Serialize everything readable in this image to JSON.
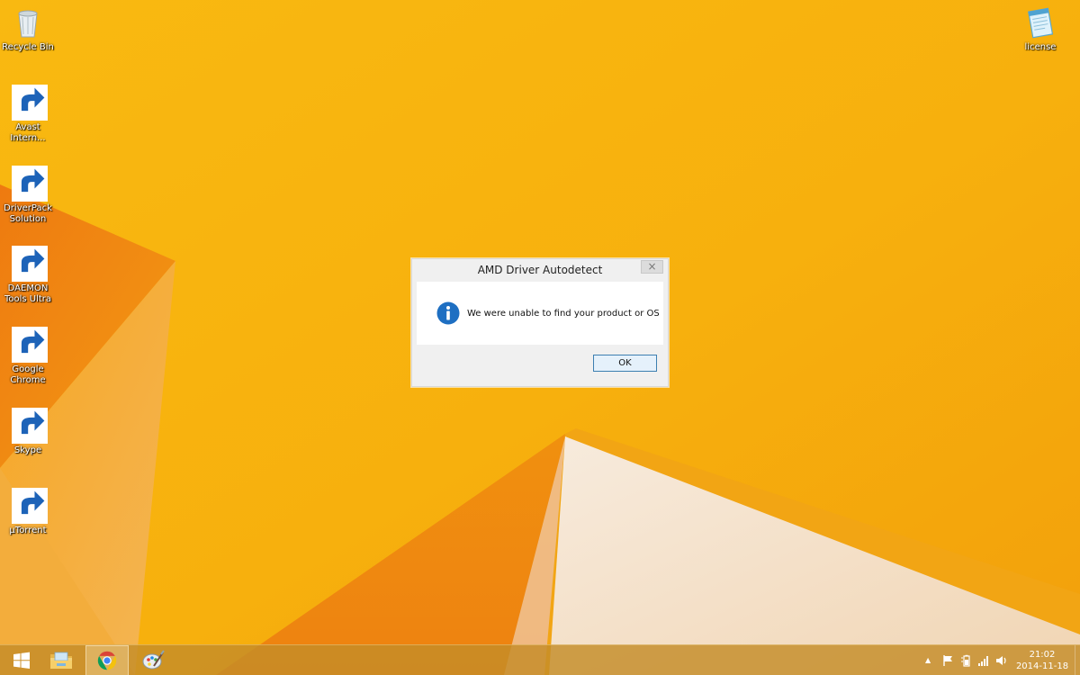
{
  "desktop_icons": [
    {
      "label": "Recycle Bin",
      "icon": "recycle-bin-icon"
    },
    {
      "label": "Avast Intern...",
      "icon": "avast-icon"
    },
    {
      "label": "DriverPack Solution",
      "icon": "driverpack-icon"
    },
    {
      "label": "DAEMON Tools Ultra",
      "icon": "daemon-tools-icon"
    },
    {
      "label": "Google Chrome",
      "icon": "chrome-icon"
    },
    {
      "label": "Skype",
      "icon": "skype-icon"
    },
    {
      "label": "µTorrent",
      "icon": "utorrent-icon"
    },
    {
      "label": "license",
      "icon": "notepad-icon"
    }
  ],
  "dialog": {
    "title": "AMD Driver Autodetect",
    "close_label": "×",
    "message": "We were unable to find your product or OS",
    "ok_label": "OK",
    "icon": "info-icon"
  },
  "taskbar": {
    "items": [
      {
        "name": "start",
        "icon": "windows-logo-icon"
      },
      {
        "name": "file-explorer",
        "icon": "folder-icon"
      },
      {
        "name": "google-chrome",
        "icon": "chrome-icon",
        "active": true
      },
      {
        "name": "paint-app",
        "icon": "paint-palette-icon"
      }
    ]
  },
  "tray": {
    "icons": [
      "show-hidden-icons-icon",
      "action-center-flag-icon",
      "battery-power-icon",
      "network-signal-icon",
      "volume-icon"
    ],
    "expand_glyph": "▲",
    "time": "21:02",
    "date": "2014-11-18"
  },
  "colors": {
    "wallpaper_base": "#f7b30f",
    "wallpaper_dark": "#ef8a0c",
    "wallpaper_light": "#f6e6cf",
    "dialog_button_border": "#3c7fb1",
    "info_blue": "#1e6fc2"
  }
}
